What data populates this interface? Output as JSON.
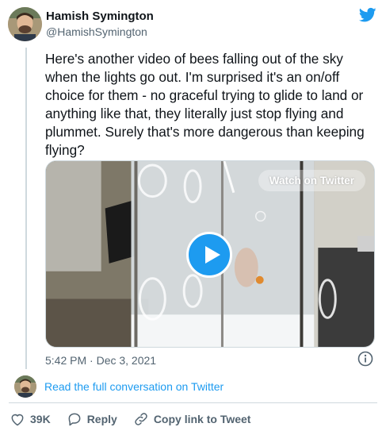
{
  "author": {
    "name": "Hamish Symington",
    "handle": "@HamishSymington"
  },
  "tweet": {
    "text": "Here's another video of bees falling out of the sky when the lights go out. I'm surprised it's an on/off choice for them - no graceful trying to glide to land or anything like that, they literally just stop flying and plummet. Surely that's more dangerous than keeping flying?",
    "timestamp": "5:42 PM · Dec 3, 2021"
  },
  "media": {
    "watch_label": "Watch on Twitter"
  },
  "conversation": {
    "link_label": "Read the full conversation on Twitter"
  },
  "actions": {
    "like_count": "39K",
    "reply_label": "Reply",
    "copy_label": "Copy link to Tweet"
  },
  "colors": {
    "accent": "#1d9bf0",
    "muted": "#536471"
  }
}
